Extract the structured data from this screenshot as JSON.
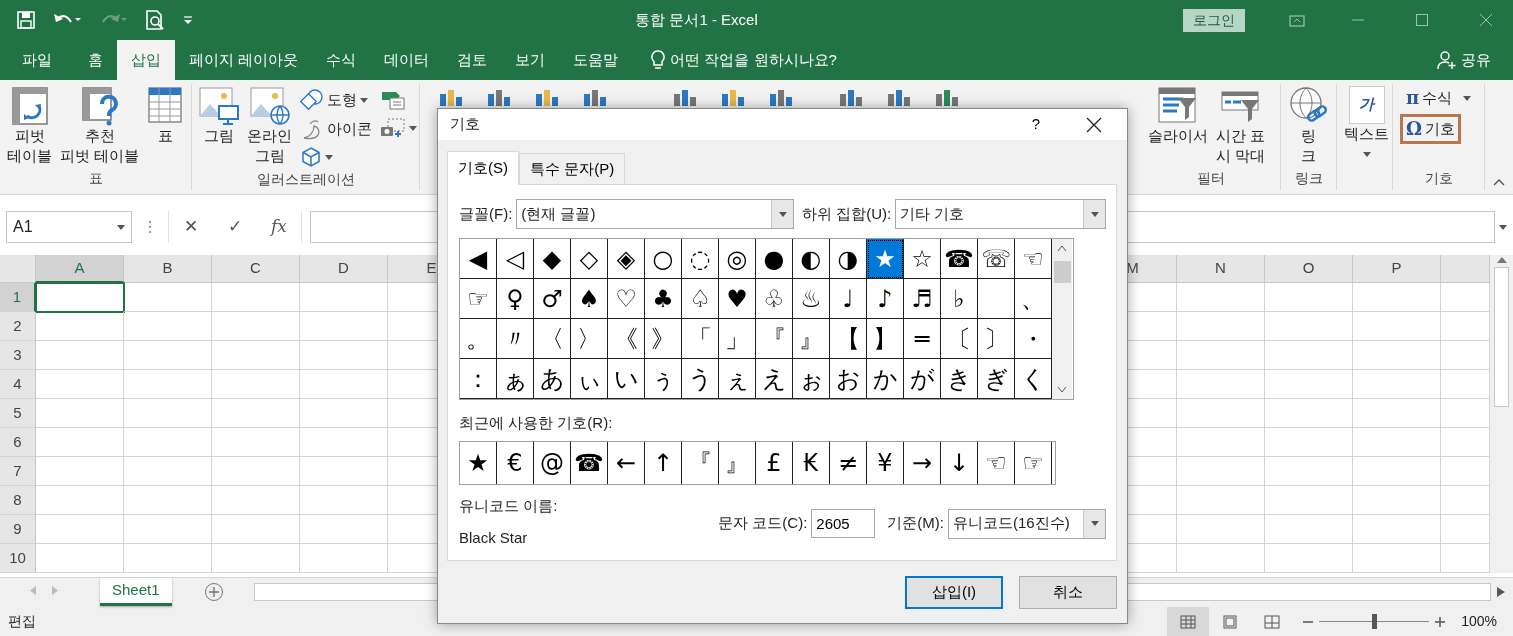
{
  "window": {
    "title": "통합 문서1  -  Excel",
    "sign_in": "로그인"
  },
  "quick_access": [
    {
      "kind": "save",
      "disabled": false
    },
    {
      "kind": "undo",
      "disabled": false
    },
    {
      "kind": "redo",
      "disabled": true
    },
    {
      "kind": "preview",
      "disabled": false
    },
    {
      "kind": "customize",
      "disabled": false
    }
  ],
  "ribbon_tabs": [
    {
      "label": "파일",
      "selected": false
    },
    {
      "label": "홈",
      "selected": false
    },
    {
      "label": "삽입",
      "selected": true
    },
    {
      "label": "페이지 레이아웃",
      "selected": false
    },
    {
      "label": "수식",
      "selected": false
    },
    {
      "label": "데이터",
      "selected": false
    },
    {
      "label": "검토",
      "selected": false
    },
    {
      "label": "보기",
      "selected": false
    },
    {
      "label": "도움말",
      "selected": false
    }
  ],
  "tell_me": "어떤 작업을 원하시나요?",
  "share": "공유",
  "ribbon_groups_left": [
    {
      "label": "표",
      "commands": [
        {
          "kind": "large",
          "label": "피벗\n테이블"
        },
        {
          "kind": "large",
          "label": "추천\n피벗 테이블"
        },
        {
          "kind": "large",
          "label": "표"
        }
      ]
    },
    {
      "label": "일러스트레이션",
      "commands": [
        {
          "kind": "large",
          "label": "그림"
        },
        {
          "kind": "large",
          "label": "온라인\n그림"
        },
        {
          "kind": "stack",
          "items": [
            {
              "label": "도형",
              "dropdown": true
            },
            {
              "label": "아이콘",
              "dropdown": false
            },
            {
              "dropdown": true
            }
          ]
        },
        {
          "kind": "stack",
          "items": [
            {
              "dropdown": false
            },
            {
              "dropdown": true
            }
          ]
        }
      ]
    }
  ],
  "ribbon_groups_right": [
    {
      "label": "필터",
      "commands": [
        {
          "kind": "large",
          "label": "슬라이서"
        },
        {
          "kind": "large",
          "label": "시간 표\n시 막대"
        }
      ]
    },
    {
      "label": "링크",
      "commands": [
        {
          "kind": "large",
          "label": "링\n크"
        }
      ]
    },
    {
      "commands": [
        {
          "kind": "text",
          "glyph": "가",
          "label": "텍스트",
          "dropdown": true
        }
      ]
    },
    {
      "label": "기호",
      "commands": [
        {
          "kind": "small",
          "glyph": "π",
          "label": "수식",
          "dropdown": true,
          "highlighted": false
        },
        {
          "kind": "small",
          "glyph": "Ω",
          "label": "기호",
          "dropdown": false,
          "highlighted": true
        }
      ]
    }
  ],
  "formula_bar": {
    "name_box": "A1",
    "cancel": "✕",
    "enter": "✓",
    "function": "fx"
  },
  "sheet": {
    "columns_left": [
      {
        "label": "A",
        "selected": true
      },
      {
        "label": "B",
        "selected": false
      },
      {
        "label": "C",
        "selected": false
      },
      {
        "label": "D",
        "selected": false
      },
      {
        "label": "E",
        "selected": false
      }
    ],
    "columns_right": [
      {
        "label": "M",
        "selected": false
      },
      {
        "label": "N",
        "selected": false
      },
      {
        "label": "O",
        "selected": false
      },
      {
        "label": "P",
        "selected": false
      }
    ],
    "rows": [
      {
        "label": "1",
        "selected": true
      },
      {
        "label": "2",
        "selected": false
      },
      {
        "label": "3",
        "selected": false
      },
      {
        "label": "4",
        "selected": false
      },
      {
        "label": "5",
        "selected": false
      },
      {
        "label": "6",
        "selected": false
      },
      {
        "label": "7",
        "selected": false
      },
      {
        "label": "8",
        "selected": false
      },
      {
        "label": "9",
        "selected": false
      },
      {
        "label": "10",
        "selected": false
      }
    ]
  },
  "sheet_tabs": [
    {
      "label": "Sheet1",
      "selected": true
    }
  ],
  "status_bar": {
    "mode": "편집",
    "views": [
      {
        "kind": "normal",
        "selected": true
      },
      {
        "kind": "layout",
        "selected": false
      },
      {
        "kind": "pagebreak",
        "selected": false
      }
    ],
    "zoom": {
      "level": 0.5,
      "reading": "100%"
    }
  },
  "dialog": {
    "title": "기호",
    "help": "?",
    "tabs": [
      {
        "label": "기호(S)",
        "selected": true
      },
      {
        "label": "특수 문자(P)",
        "selected": false
      }
    ],
    "font_label": "글꼴(F):",
    "font_value": "(현재 글꼴)",
    "subset_label": "하위 집합(U):",
    "subset_value": "기타 기호",
    "symbols": [
      [
        {
          "char": "◀",
          "selected": false
        },
        {
          "char": "◁",
          "selected": false
        },
        {
          "char": "◆",
          "selected": false
        },
        {
          "char": "◇",
          "selected": false
        },
        {
          "char": "◈",
          "selected": false
        },
        {
          "char": "○",
          "selected": false
        },
        {
          "char": "◌",
          "selected": false
        },
        {
          "char": "◎",
          "selected": false
        },
        {
          "char": "●",
          "selected": false
        },
        {
          "char": "◐",
          "selected": false
        },
        {
          "char": "◑",
          "selected": false
        },
        {
          "char": "★",
          "selected": true
        },
        {
          "char": "☆",
          "selected": false
        },
        {
          "char": "☎",
          "selected": false
        },
        {
          "char": "☏",
          "selected": false
        },
        {
          "char": "☜",
          "selected": false
        }
      ],
      [
        {
          "char": "☞",
          "selected": false
        },
        {
          "char": "♀",
          "selected": false
        },
        {
          "char": "♂",
          "selected": false
        },
        {
          "char": "♠",
          "selected": false
        },
        {
          "char": "♡",
          "selected": false
        },
        {
          "char": "♣",
          "selected": false
        },
        {
          "char": "♤",
          "selected": false
        },
        {
          "char": "♥",
          "selected": false
        },
        {
          "char": "♧",
          "selected": false
        },
        {
          "char": "♨",
          "selected": false
        },
        {
          "char": "♩",
          "selected": false
        },
        {
          "char": "♪",
          "selected": false
        },
        {
          "char": "♬",
          "selected": false
        },
        {
          "char": "♭",
          "selected": false
        },
        {
          "selected": false
        },
        {
          "char": "、",
          "selected": false
        }
      ],
      [
        {
          "char": "。",
          "selected": false
        },
        {
          "char": "〃",
          "selected": false
        },
        {
          "char": "〈",
          "selected": false
        },
        {
          "char": "〉",
          "selected": false
        },
        {
          "char": "《",
          "selected": false
        },
        {
          "char": "》",
          "selected": false
        },
        {
          "char": "「",
          "selected": false
        },
        {
          "char": "」",
          "selected": false
        },
        {
          "char": "『",
          "selected": false
        },
        {
          "char": "』",
          "selected": false
        },
        {
          "char": "【",
          "selected": false
        },
        {
          "char": "】",
          "selected": false
        },
        {
          "char": "═",
          "selected": false
        },
        {
          "char": "〔",
          "selected": false
        },
        {
          "char": "〕",
          "selected": false
        },
        {
          "char": "・",
          "selected": false
        }
      ],
      [
        {
          "char": "：",
          "selected": false
        },
        {
          "char": "ぁ",
          "selected": false
        },
        {
          "char": "あ",
          "selected": false
        },
        {
          "char": "ぃ",
          "selected": false
        },
        {
          "char": "い",
          "selected": false
        },
        {
          "char": "ぅ",
          "selected": false
        },
        {
          "char": "う",
          "selected": false
        },
        {
          "char": "ぇ",
          "selected": false
        },
        {
          "char": "え",
          "selected": false
        },
        {
          "char": "ぉ",
          "selected": false
        },
        {
          "char": "お",
          "selected": false
        },
        {
          "char": "か",
          "selected": false
        },
        {
          "char": "が",
          "selected": false
        },
        {
          "char": "き",
          "selected": false
        },
        {
          "char": "ぎ",
          "selected": false
        },
        {
          "char": "く",
          "selected": false
        }
      ]
    ],
    "recent_label": "최근에 사용한 기호(R):",
    "recent": [
      "★",
      "€",
      "@",
      "☎",
      "←",
      "↑",
      "『",
      "』",
      "£",
      "₭",
      "≠",
      "¥",
      "→",
      "↓",
      "☜",
      "☞"
    ],
    "unicode_name_label": "유니코드 이름:",
    "unicode_name": "Black Star",
    "char_code_label": "문자 코드(C):",
    "char_code": "2605",
    "base_label": "기준(M):",
    "base_value": "유니코드(16진수)",
    "buttons": [
      {
        "label": "삽입(I)",
        "default": true
      },
      {
        "label": "취소",
        "default": false
      }
    ]
  }
}
